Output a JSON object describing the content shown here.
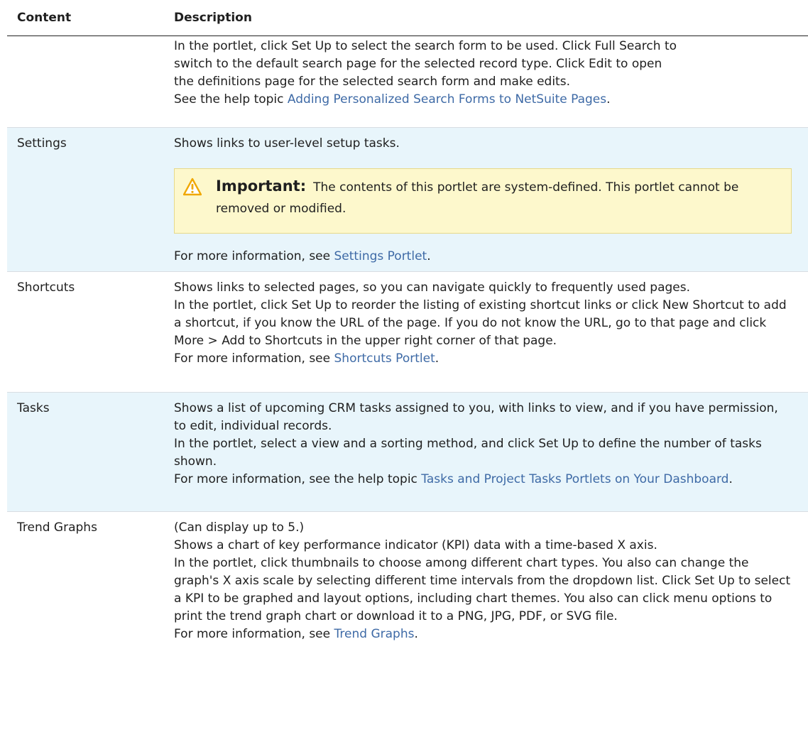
{
  "header": {
    "content": "Content",
    "description": "Description"
  },
  "row0": {
    "l1": "In the portlet, click Set Up to select the search form to be used. Click Full Search to",
    "l2": "switch to the default search page for the selected record type. Click Edit to open",
    "l3": "the definitions page for the selected search form and make edits.",
    "see_prefix": "See the help topic ",
    "see_link": "Adding Personalized Search Forms to NetSuite Pages",
    "see_suffix": "."
  },
  "settings": {
    "name": "Settings",
    "desc": "Shows links to user-level setup tasks.",
    "note_label": "Important:",
    "note_text": "The contents of this portlet are system-defined. This portlet cannot be removed or modified.",
    "more_prefix": "For more information, see ",
    "more_link": "Settings Portlet",
    "more_suffix": "."
  },
  "shortcuts": {
    "name": "Shortcuts",
    "desc": "Shows links to selected pages, so you can navigate quickly to frequently used pages.",
    "p2": "In the portlet, click Set Up to reorder the listing of existing shortcut links or click New Shortcut to add a shortcut, if you know the URL of the page. If you do not know the URL, go to that page and click More > Add to Shortcuts in the upper right corner of that page.",
    "more_prefix": "For more information, see ",
    "more_link": "Shortcuts Portlet",
    "more_suffix": "."
  },
  "tasks": {
    "name": "Tasks",
    "desc": "Shows a list of upcoming CRM tasks assigned to you, with links to view, and if you have permission, to edit, individual records.",
    "p2": "In the portlet, select a view and a sorting method, and click Set Up to define the number of tasks shown.",
    "more_prefix": "For more information, see the help topic ",
    "more_link": "Tasks and Project Tasks Portlets on Your Dashboard",
    "more_suffix": "."
  },
  "trend": {
    "name": "Trend Graphs",
    "p1": "(Can display up to 5.)",
    "p2": "Shows a chart of key performance indicator (KPI) data with a time-based X axis.",
    "p3": "In the portlet, click thumbnails to choose among different chart types. You also can change the graph's X axis scale by selecting different time intervals from the dropdown list. Click Set Up to select a KPI to be graphed and layout options, including chart themes. You also can click menu options to print the trend graph chart or download it to a PNG, JPG, PDF, or SVG file.",
    "more_prefix": "For more information, see ",
    "more_link": "Trend Graphs",
    "more_suffix": "."
  },
  "colors": {
    "link": "#3e6aa6",
    "shade": "#e8f5fb",
    "note_bg": "#fdf8cc",
    "warn": "#f0a800"
  }
}
